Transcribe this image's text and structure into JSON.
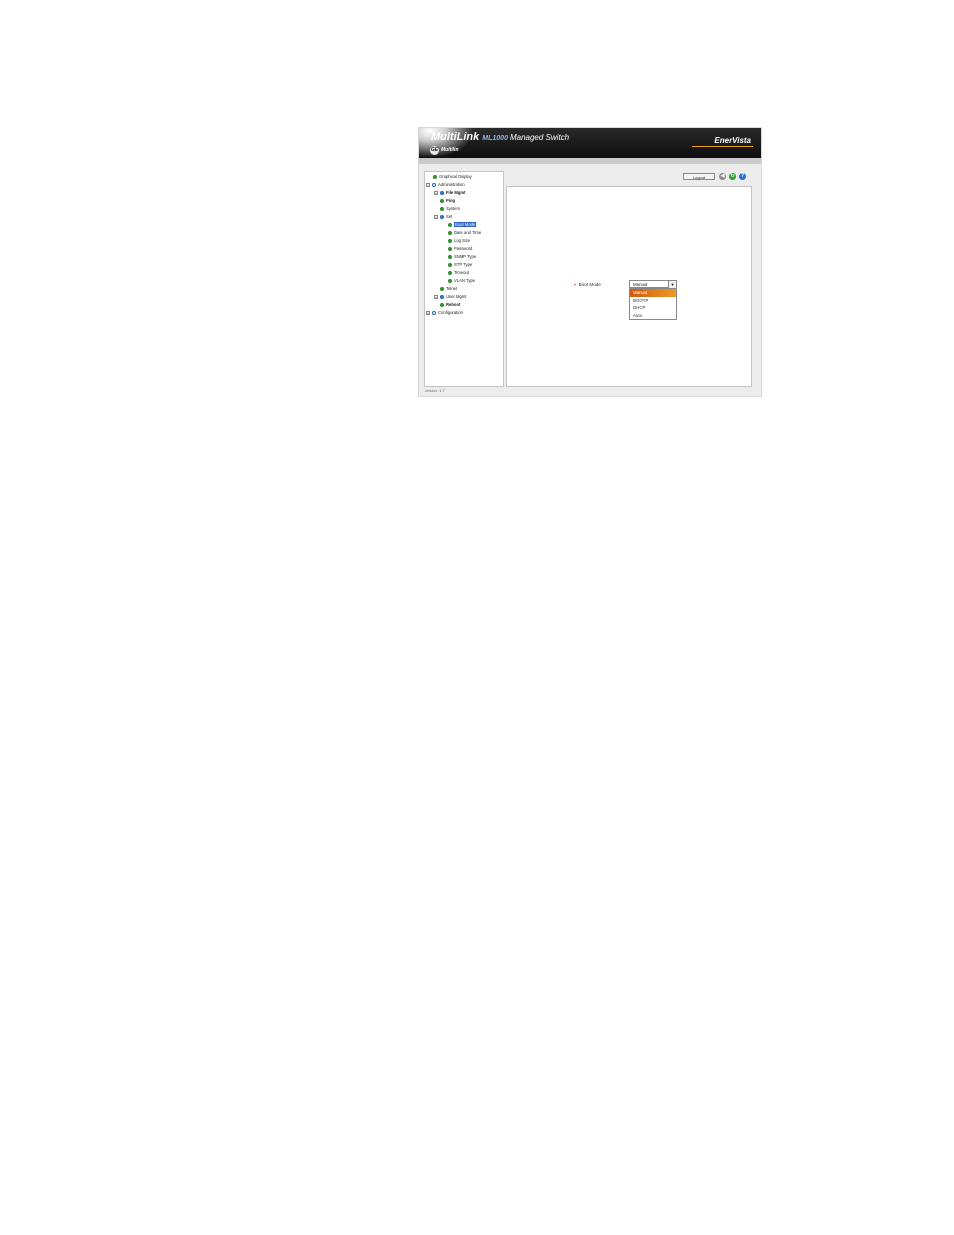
{
  "header": {
    "brand": "MultiLink",
    "model": "ML1000",
    "product": "Managed Switch",
    "company": "Multilin",
    "logo": "GE",
    "partner": "EnerVista"
  },
  "toolbar": {
    "logout_label": "Logout",
    "icons": [
      "back-icon",
      "refresh-icon",
      "help-icon"
    ]
  },
  "tree": {
    "graphical_display": "Graphical Display",
    "administration": "Administration",
    "file_mgmt": "File Mgmt",
    "ping": "Ping",
    "system": "System",
    "set": "Set",
    "boot_mode": "Boot Mode",
    "date_time": "Date and Time",
    "log_size": "Log Size",
    "password": "Password",
    "snmp_type": "SNMP Type",
    "stp_type": "STP Type",
    "timeout": "Timeout",
    "vlan_type": "VLAN Type",
    "telnet": "Telnet",
    "user_mgmt": "User Mgmt",
    "reboot": "Reboot",
    "configuration": "Configuration"
  },
  "form": {
    "boot_mode_label": "Boot Mode",
    "selected": "Manual",
    "options": [
      "Manual",
      "BOOTP",
      "DHCP",
      "Auto"
    ]
  },
  "footer": {
    "version": "version : 1.7"
  },
  "colors": {
    "banner": "#111111",
    "selection": "#2f63c8",
    "dropdown_highlight": "#e07a18",
    "tree_bullet": "#2f9e2f"
  }
}
